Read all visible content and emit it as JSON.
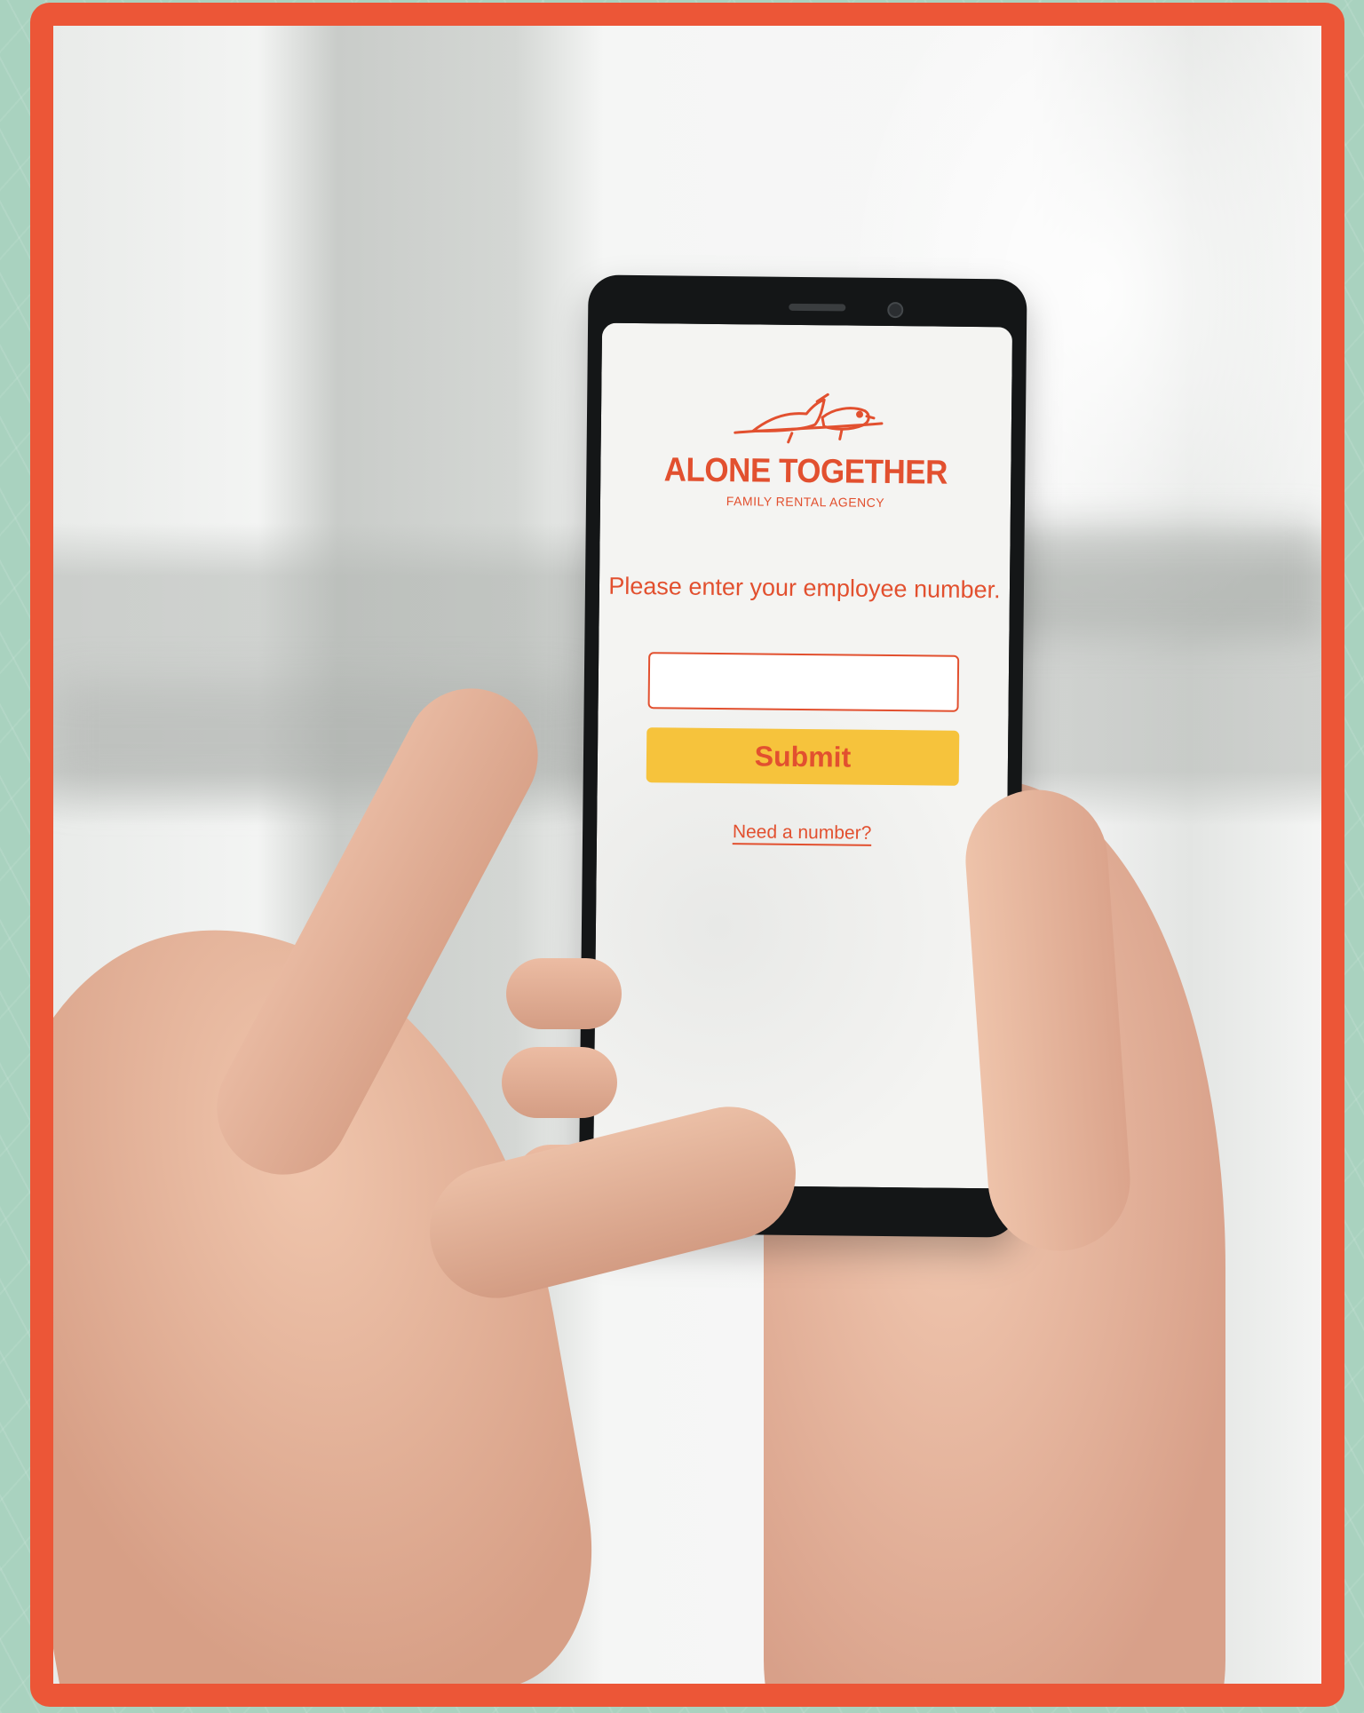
{
  "app": {
    "brand_name": "ALONE TOGETHER",
    "brand_tagline": "FAMILY RENTAL AGENCY",
    "logo_icon": "two-birds-on-branch-icon"
  },
  "login": {
    "prompt": "Please enter your employee number.",
    "employee_number_value": "",
    "submit_label": "Submit",
    "help_link": "Need a number?"
  },
  "colors": {
    "frame": "#ec5637",
    "background": "#a9d2bf",
    "brand_text": "#e2502f",
    "button": "#f6c33c"
  }
}
